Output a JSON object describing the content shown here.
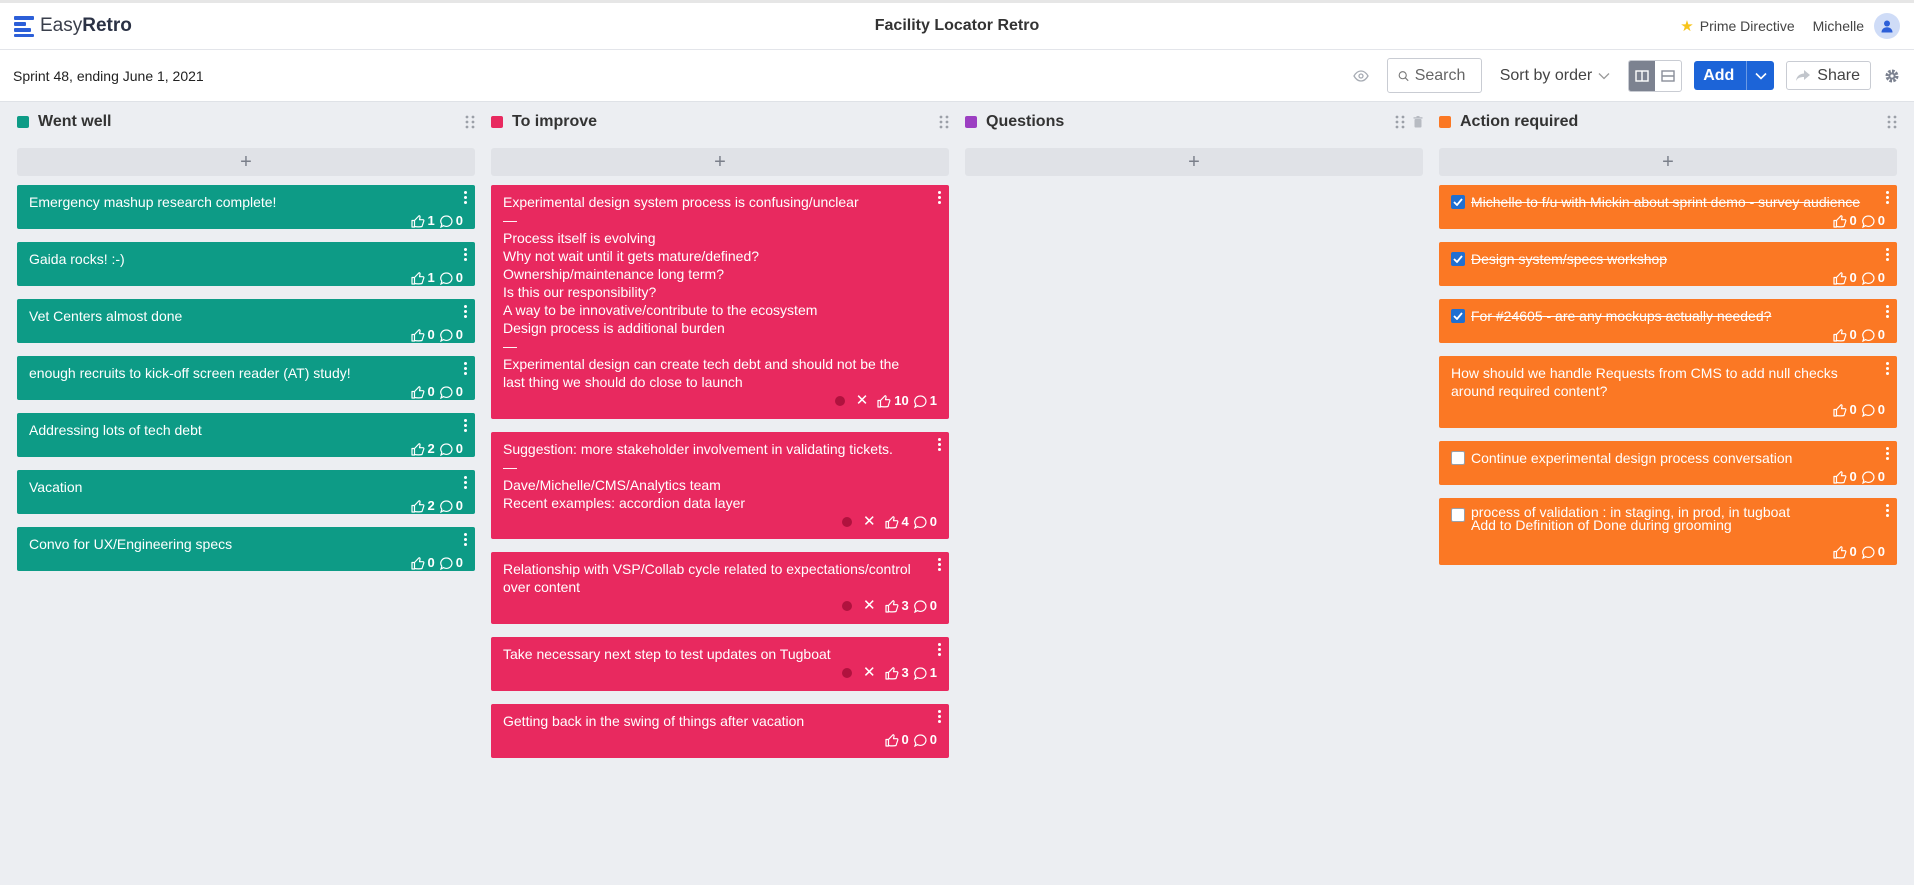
{
  "app": {
    "logo_light": "Easy",
    "logo_bold": "Retro"
  },
  "header": {
    "board_title": "Facility Locator Retro",
    "prime_directive": "Prime Directive",
    "user_name": "Michelle"
  },
  "toolbar": {
    "sprint_info": "Sprint 48, ending June 1, 2021",
    "search_placeholder": "Search",
    "sort_label": "Sort by order",
    "add_label": "Add",
    "share_label": "Share"
  },
  "colors": {
    "went_well": "#0d9b86",
    "to_improve": "#e8295f",
    "questions": "#9c3fc2",
    "action_required": "#fb7824",
    "accent": "#1c64d8"
  },
  "columns": [
    {
      "title": "Went well",
      "add": "+",
      "cards": [
        {
          "text": "Emergency mashup research complete!",
          "likes": "1",
          "comments": "0"
        },
        {
          "text": "Gaida rocks! :-)",
          "likes": "1",
          "comments": "0"
        },
        {
          "text": "Vet Centers almost done",
          "likes": "0",
          "comments": "0"
        },
        {
          "text": "enough recruits to kick-off screen reader (AT) study!",
          "likes": "0",
          "comments": "0"
        },
        {
          "text": "Addressing lots of tech debt",
          "likes": "2",
          "comments": "0"
        },
        {
          "text": "Vacation",
          "likes": "2",
          "comments": "0"
        },
        {
          "text": "Convo for UX/Engineering specs",
          "likes": "0",
          "comments": "0"
        }
      ]
    },
    {
      "title": "To improve",
      "add": "+",
      "cards": [
        {
          "text": "Experimental design system process is confusing/unclear\n—\nProcess itself is evolving\nWhy not wait until it gets mature/defined?\nOwnership/maintenance long term?\nIs this our responsibility?\nA way to be innovative/contribute to the ecosystem\nDesign process is additional burden\n—\nExperimental design can create tech debt and should not be the last thing we should do close to launch",
          "likes": "10",
          "comments": "1",
          "x": "✕"
        },
        {
          "text": "Suggestion: more stakeholder involvement in validating tickets.\n—\nDave/Michelle/CMS/Analytics team\nRecent examples: accordion data layer",
          "likes": "4",
          "comments": "0",
          "x": "✕"
        },
        {
          "text": "Relationship with VSP/Collab cycle related to expectations/control over content",
          "likes": "3",
          "comments": "0",
          "x": "✕"
        },
        {
          "text": "Take necessary next step to test updates on Tugboat",
          "likes": "3",
          "comments": "1",
          "x": "✕"
        },
        {
          "text": "Getting back in the swing of things after vacation",
          "likes": "0",
          "comments": "0"
        }
      ]
    },
    {
      "title": "Questions",
      "add": "+",
      "cards": []
    },
    {
      "title": "Action required",
      "add": "+",
      "cards": [
        {
          "text": "Michelle to f/u with Mickin about sprint demo - survey audience",
          "likes": "0",
          "comments": "0",
          "checked": true
        },
        {
          "text": "Design system/specs workshop",
          "likes": "0",
          "comments": "0",
          "checked": true
        },
        {
          "text": "For #24605 - are any mockups actually needed?",
          "likes": "0",
          "comments": "0",
          "checked": true
        },
        {
          "text": "How should we handle Requests from CMS to add null checks around required content?",
          "likes": "0",
          "comments": "0"
        },
        {
          "text": "Continue experimental design process conversation",
          "likes": "0",
          "comments": "0",
          "checked": false
        },
        {
          "text": "process of validation : in staging, in prod, in tugboat\nAdd to Definition of Done during grooming",
          "likes": "0",
          "comments": "0",
          "checked": false
        }
      ]
    }
  ]
}
